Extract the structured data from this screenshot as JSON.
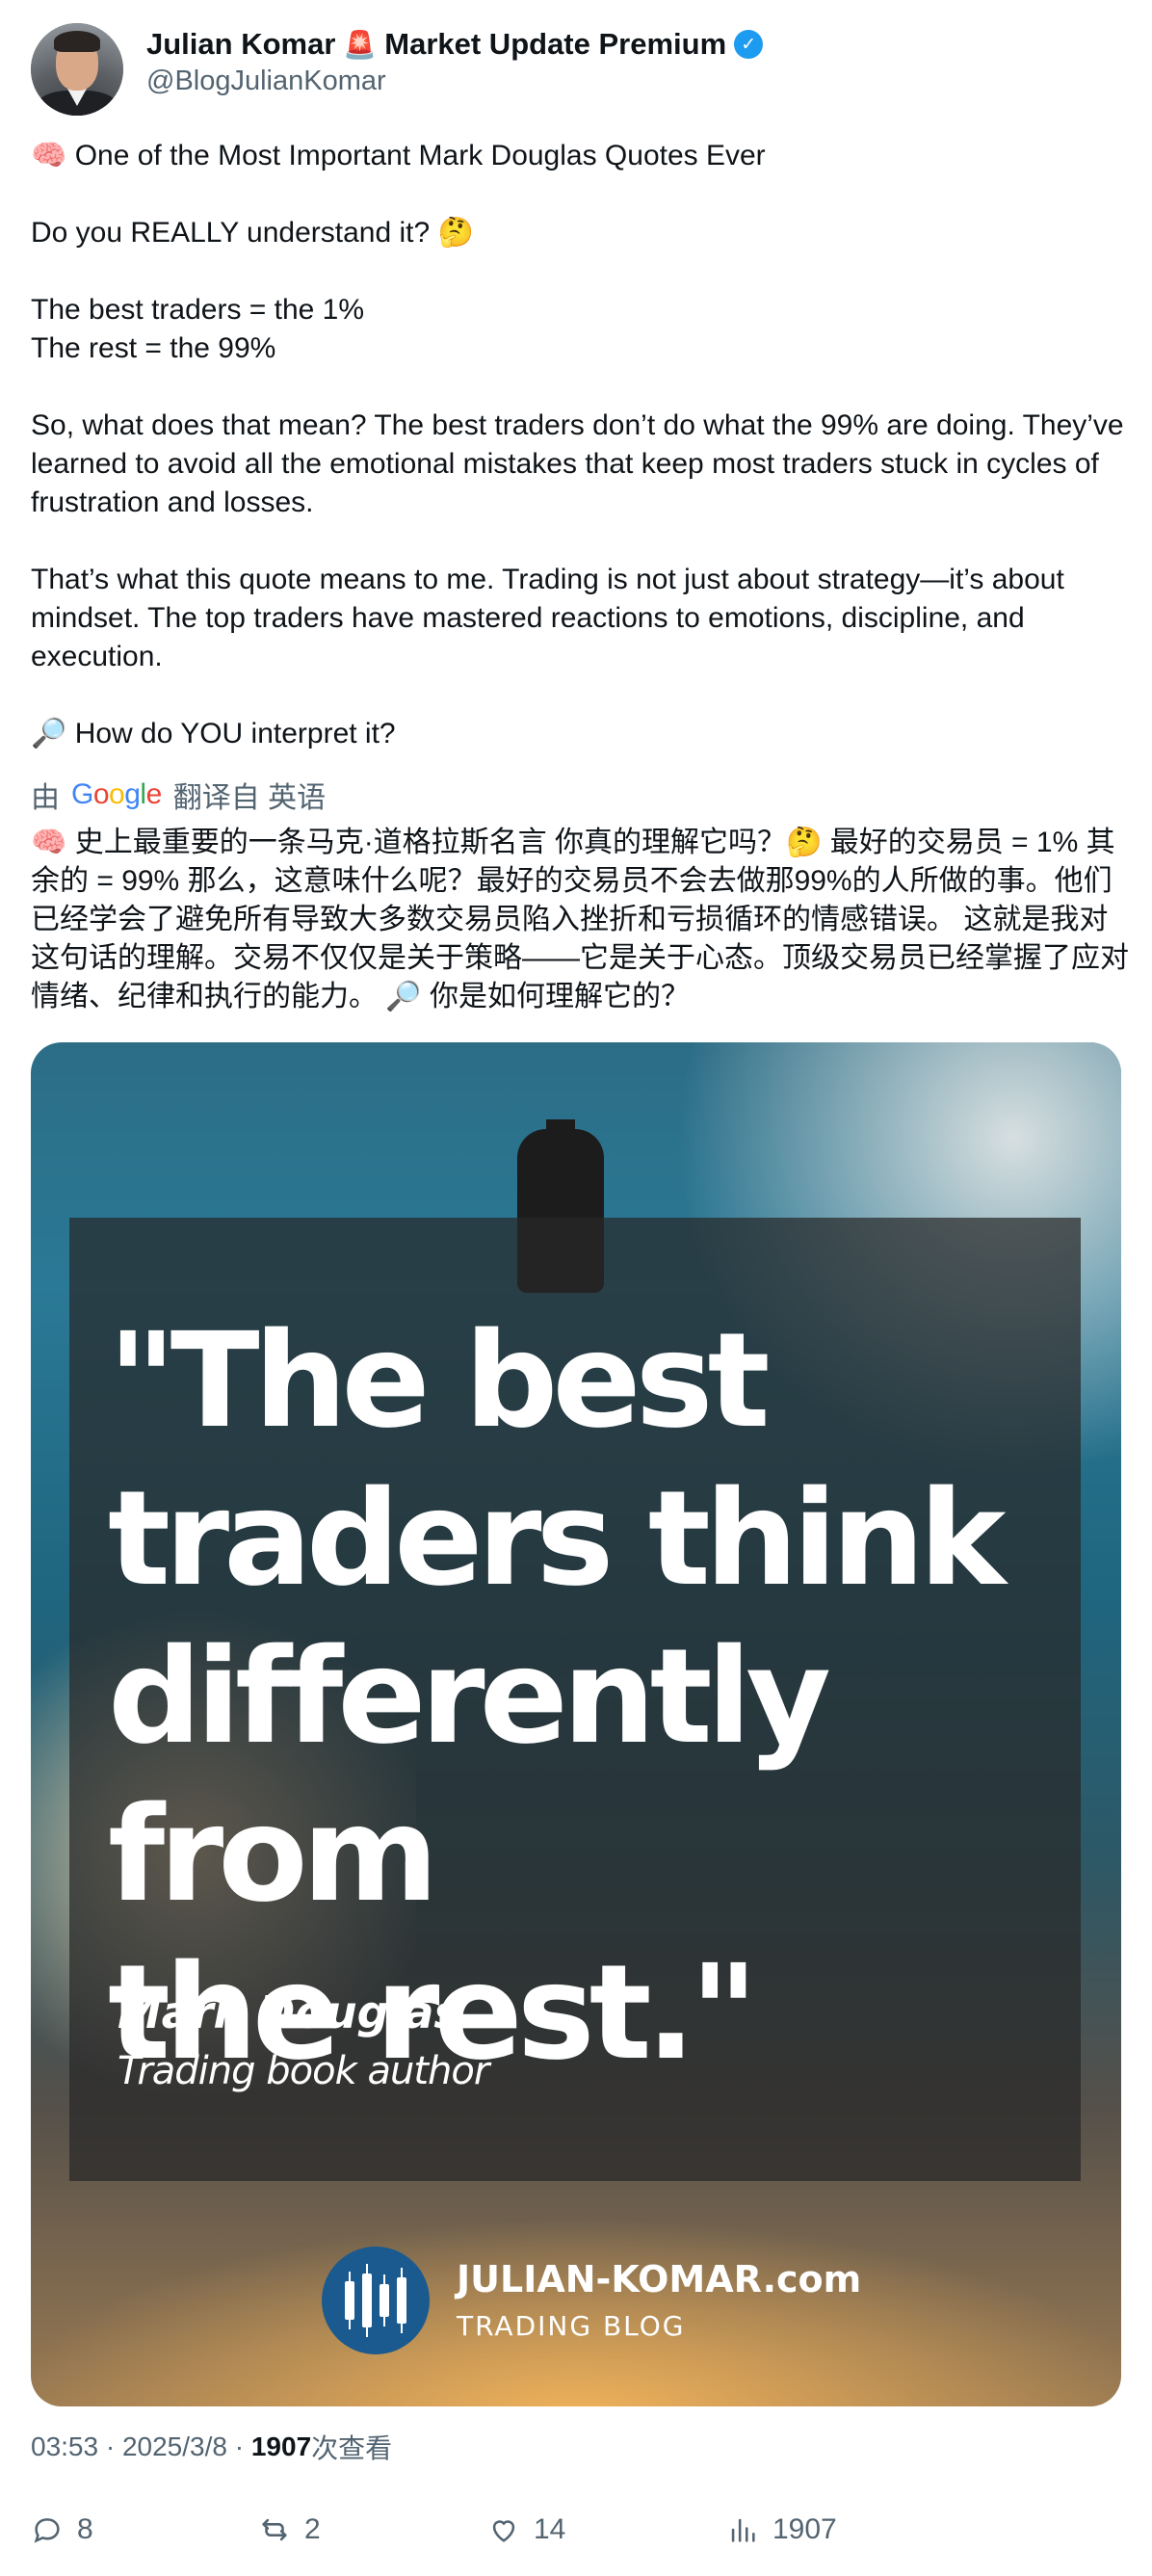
{
  "author": {
    "display_name": "Julian Komar",
    "siren_emoji": "🚨",
    "subtitle": "Market Update Premium",
    "handle": "@BlogJulianKomar",
    "verified_mark": "✓"
  },
  "tweet": {
    "text": "🧠 One of the Most Important Mark Douglas Quotes Ever\n\nDo you REALLY understand it? 🤔\n\nThe best traders = the 1%\nThe rest = the 99%\n\nSo, what does that mean? The best traders don’t do what the 99% are doing. They’ve learned to avoid all the emotional mistakes that keep most traders stuck in cycles of frustration and losses.\n\nThat’s what this quote means to me. Trading is not just about strategy—it’s about mindset. The top traders have mastered reactions to emotions, discipline, and execution.\n\n🔎 How do YOU interpret it?"
  },
  "translation": {
    "prefix": "由",
    "google": [
      "G",
      "o",
      "o",
      "g",
      "l",
      "e"
    ],
    "suffix": "翻译自 英语",
    "text": "🧠 史上最重要的一条马克·道格拉斯名言 你真的理解它吗？🤔 最好的交易员 = 1% 其余的 = 99% 那么，这意味什么呢？最好的交易员不会去做那99%的人所做的事。他们已经学会了避免所有导致大多数交易员陷入挫折和亏损循环的情感错误。 这就是我对这句话的理解。交易不仅仅是关于策略——它是关于心态。顶级交易员已经掌握了应对情绪、纪律和执行的能力。 🔎 你是如何理解它的？"
  },
  "media": {
    "quote": "\"The best\ntraders think\ndifferently from\nthe rest.\"",
    "author": "Mark Douglas",
    "author_role": "Trading book author",
    "brand_name": "JULIAN-KOMAR.com",
    "brand_sub": "TRADING BLOG"
  },
  "meta": {
    "time": "03:53",
    "sep1": " · ",
    "date": "2025/3/8",
    "sep2": " · ",
    "views_count": "1907",
    "views_label": "次查看"
  },
  "actions": {
    "replies": "8",
    "reposts": "2",
    "likes": "14",
    "views": "1907"
  },
  "colors": {
    "verified": "#1d9bf0",
    "muted_text": "#536471",
    "primary_text": "#0f1419"
  }
}
